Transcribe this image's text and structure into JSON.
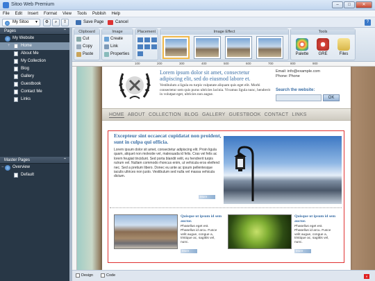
{
  "app": {
    "title": "Sitoo Web Premium"
  },
  "menu": [
    "File",
    "Edit",
    "Insert",
    "Format",
    "View",
    "Tools",
    "Publish",
    "Help"
  ],
  "site_selector": {
    "value": "My Sitoo"
  },
  "toolbar": {
    "save": "Save Page",
    "cancel": "Cancel"
  },
  "pages_panel": {
    "title": "Pages",
    "root": "My Website",
    "items": [
      "Home",
      "About Me",
      "My Collection",
      "Blog",
      "Gallery",
      "Guestbook",
      "Contact Me",
      "Links"
    ],
    "selected": "Home"
  },
  "master_panel": {
    "title": "Master Pages",
    "root": "Overview",
    "items": [
      "Default"
    ]
  },
  "ribbon": {
    "clipboard": {
      "title": "Clipboard",
      "cut": "Cut",
      "copy": "Copy",
      "paste": "Paste"
    },
    "image": {
      "title": "Image",
      "create": "Create",
      "link": "Link",
      "properties": "Properties"
    },
    "placement": {
      "title": "Placement"
    },
    "image_effect": {
      "title": "Image Effect"
    },
    "tools": {
      "title": "Tools",
      "palette": "Palette",
      "gre": "GRE",
      "files": "Files"
    }
  },
  "ruler": [
    "100",
    "200",
    "300",
    "400",
    "500",
    "600",
    "700",
    "800",
    "900"
  ],
  "page": {
    "header_title": "Lorem ipsum dolor sit amet, consectetur adipiscing elit, sed do eiusmod labore et.",
    "header_text": "Vestibulum a ligula eu turpis vulputate aliquam quis eget elit. Morbi consectetur sem quis purus ultricies lacinia. Vivamus ligula nunc, hendrerit in volutpat eget, ultricies non augue.",
    "email": "Email: info@example.com",
    "phone": "Phone: Phone",
    "search_label": "Search the website:",
    "ok": "OK",
    "nav": [
      "HOME",
      "ABOUT",
      "COLLECTION",
      "BLOG",
      "GALLERY",
      "GUESTBOOK",
      "CONTACT",
      "LINKS"
    ],
    "block1_title": "Excepteur sint occaecat cupidatat non proident, sunt in culpa qui officia.",
    "block1_text": "Lorem ipsum dolor sit amet, consectetur adipiscing elit. Proin ligula quam, aliquet non molestie vel, malesuada id felis. Cras vel felis ac lorem feugiat tincidunt. Sed porta blandit velit, eu hendrerit turpis rutrum vel. Nullam commodo rhoncus enim, ut vehicula eros eleifend nec. Sed a pretium libero. Donec eu ante ac ipsum pellentesque iaculis ultrices non justo. Vestibulum sed nulla vel massa vehicula dictum.",
    "more": "More",
    "cap1_title": "Quisque ut ipsum id sem auctor.",
    "cap1_text": "Phasellus eget est. Phasellus id arcu. Fusce velit augue, congue a, tristique ac, sagittis vel, nunc.",
    "cap2_title": "Quisque ut ipsum id sem auctor.",
    "cap2_text": "Phasellus eget est. Phasellus id arcu. Fusce velit augue, congue a, tristique ac, sagittis vel, nunc."
  },
  "view_tabs": {
    "design": "Design",
    "code": "Code"
  },
  "colors": {
    "accent": "#3a6ea5",
    "sidebar": "#283746",
    "selection": "#e03030"
  }
}
